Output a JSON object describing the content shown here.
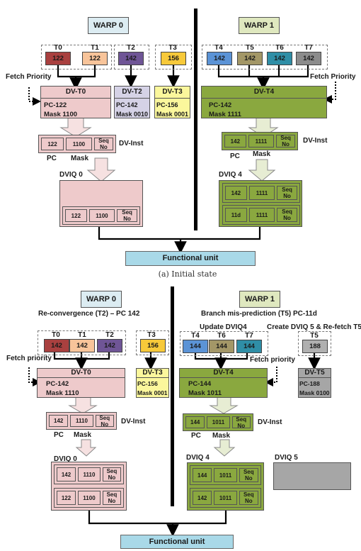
{
  "panel_a": {
    "caption": "(a) Initial state",
    "warp0": {
      "title": "WARP 0",
      "fetch_priority": "Fetch Priority",
      "threads": [
        {
          "id": "T0",
          "pc": "122",
          "color": "#a9403f"
        },
        {
          "id": "T1",
          "pc": "122",
          "color": "#f8c49a"
        },
        {
          "id": "T2",
          "pc": "142",
          "color": "#6f5596"
        },
        {
          "id": "T3",
          "pc": "156",
          "color": "#f7c93a"
        }
      ],
      "dv_boxes": [
        {
          "name": "DV-T0",
          "pc": "PC-122",
          "mask": "Mask 1100"
        },
        {
          "name": "DV-T2",
          "pc": "PC-142",
          "mask": "Mask 0010"
        },
        {
          "name": "DV-T3",
          "pc": "PC-156",
          "mask": "Mask 0001"
        }
      ],
      "dv_inst": {
        "label": "DV-Inst",
        "pc": "122",
        "mask": "1100",
        "seq": "Seq No",
        "pc_label": "PC",
        "mask_label": "Mask"
      },
      "dviq": {
        "label": "DVIQ 0",
        "entries": [
          {
            "pc": "122",
            "mask": "1100",
            "seq": "Seq No"
          }
        ]
      }
    },
    "warp1": {
      "title": "WARP 1",
      "fetch_priority": "Fetch Priority",
      "threads": [
        {
          "id": "T4",
          "pc": "142",
          "color": "#5b93d6"
        },
        {
          "id": "T5",
          "pc": "142",
          "color": "#a39767"
        },
        {
          "id": "T6",
          "pc": "142",
          "color": "#2f8ea6"
        },
        {
          "id": "T7",
          "pc": "142",
          "color": "#8c8c8c"
        }
      ],
      "dv_boxes": [
        {
          "name": "DV-T4",
          "pc": "PC-142",
          "mask": "Mask 1111"
        }
      ],
      "dv_inst": {
        "label": "DV-Inst",
        "pc": "142",
        "mask": "1111",
        "seq": "Seq No",
        "pc_label": "PC",
        "mask_label": "Mask"
      },
      "dviq": {
        "label": "DVIQ 4",
        "entries": [
          {
            "pc": "142",
            "mask": "1111",
            "seq": "Seq No"
          },
          {
            "pc": "11d",
            "mask": "1111",
            "seq": "Seq No"
          }
        ]
      }
    },
    "functional_unit": "Functional unit"
  },
  "panel_b": {
    "warp0": {
      "title": "WARP 0",
      "note": "Re-convergence (T2) – PC 142",
      "fetch_priority": "Fetch priority",
      "threads": [
        {
          "id": "T0",
          "pc": "142",
          "color": "#a9403f"
        },
        {
          "id": "T1",
          "pc": "142",
          "color": "#f8c49a"
        },
        {
          "id": "T2",
          "pc": "142",
          "color": "#6f5596"
        },
        {
          "id": "T3",
          "pc": "156",
          "color": "#f7c93a"
        }
      ],
      "dv_boxes": [
        {
          "name": "DV-T0",
          "pc": "PC-142",
          "mask": "Mask 1110"
        },
        {
          "name": "DV-T3",
          "pc": "PC-156",
          "mask": "Mask 0001"
        }
      ],
      "dv_inst": {
        "label": "DV-Inst",
        "pc": "142",
        "mask": "1110",
        "seq": "Seq No",
        "pc_label": "PC",
        "mask_label": "Mask"
      },
      "dviq": {
        "label": "DVIQ 0",
        "entries": [
          {
            "pc": "142",
            "mask": "1110",
            "seq": "Seq No"
          },
          {
            "pc": "122",
            "mask": "1100",
            "seq": "Seq No"
          }
        ]
      }
    },
    "warp1": {
      "title": "WARP 1",
      "note": "Branch mis-prediction (T5) PC-11d",
      "update_note": "Update DVIQ4",
      "create_note": "Create DVIQ 5 & Re-fetch T5",
      "fetch_priority": "Fetch priority",
      "threads": [
        {
          "id": "T4",
          "pc": "144",
          "color": "#5b93d6"
        },
        {
          "id": "T6",
          "pc": "144",
          "color": "#a39767"
        },
        {
          "id": "T7",
          "pc": "144",
          "color": "#2f8ea6"
        },
        {
          "id": "T5",
          "pc": "188",
          "color": "#b0b0b0"
        }
      ],
      "dv_boxes": [
        {
          "name": "DV-T4",
          "pc": "PC-144",
          "mask": "Mask 1011"
        },
        {
          "name": "DV-T5",
          "pc": "PC-188",
          "mask": "Mask 0100"
        }
      ],
      "dv_inst": {
        "label": "DV-Inst",
        "pc": "144",
        "mask": "1011",
        "seq": "Seq No",
        "pc_label": "PC",
        "mask_label": "Mask"
      },
      "dviq": {
        "label": "DVIQ 4",
        "entries": [
          {
            "pc": "144",
            "mask": "1011",
            "seq": "Seq No"
          },
          {
            "pc": "142",
            "mask": "1011",
            "seq": "Seq No"
          }
        ]
      },
      "dviq5": {
        "label": "DVIQ 5"
      }
    },
    "functional_unit": "Functional unit"
  }
}
